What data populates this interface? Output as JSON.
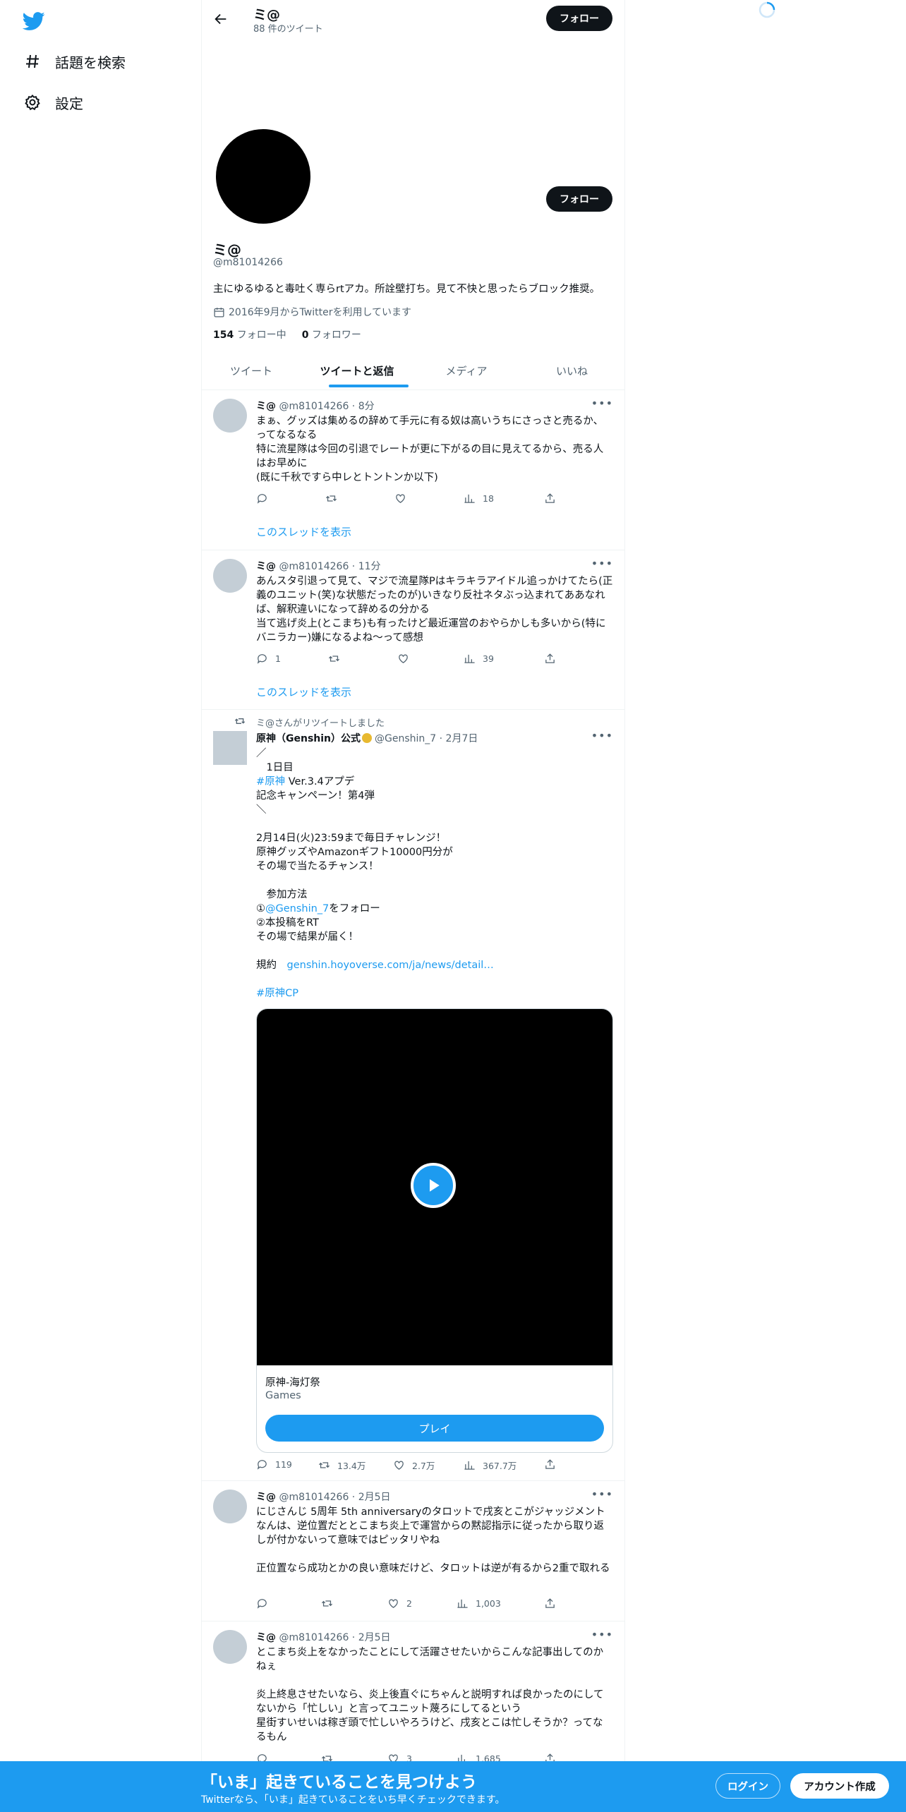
{
  "nav": {
    "items": [
      {
        "label": "話題を検索",
        "icon": "hash-icon"
      },
      {
        "label": "設定",
        "icon": "gear-icon"
      }
    ]
  },
  "header": {
    "name": "ミ@",
    "tweet_count": "88 件のツイート",
    "follow_label": "フォロー"
  },
  "profile": {
    "name": "ミ@",
    "handle": "@m81014266",
    "bio": "主にゆるゆると毒吐く専らrtアカ。所詮壁打ち。見て不快と思ったらブロック推奨。",
    "joined": "2016年9月からTwitterを利用しています",
    "following_count": "154",
    "following_label": "フォロー中",
    "followers_count": "0",
    "followers_label": "フォロワー",
    "follow_label": "フォロー"
  },
  "tabs": [
    "ツイート",
    "ツイートと返信",
    "メディア",
    "いいね"
  ],
  "tweets": [
    {
      "name": "ミ@",
      "meta": "@m81014266 · 8分",
      "body": "まぁ、グッズは集めるの辞めて手元に有る奴は高いうちにさっさと売るか、ってなるなる\n特に流星隊は今回の引退でレートが更に下がるの目に見えてるから、売る人はお早めに\n(既に千秋ですら中レとトントンか以下)",
      "reply": "",
      "retweet": "",
      "like": "",
      "views": "18",
      "thread_link": "このスレッドを表示"
    },
    {
      "name": "ミ@",
      "meta": "@m81014266 · 11分",
      "body": "あんスタ引退って見て、マジで流星隊Pはキラキラアイドル追っかけてたら(正義のユニット(笑)な状態だったのが)いきなり反社ネタぶっ込まれてああなれば、解釈違いになって辞めるの分かる\n当て逃げ炎上(とこまち)も有ったけど最近運営のおやらかしも多いから(特にバニラカー)嫌になるよね〜って感想",
      "reply": "1",
      "retweet": "",
      "like": "",
      "views": "39",
      "thread_link": "このスレッドを表示"
    },
    {
      "retweeted_by": "ミ@さんがリツイートしました",
      "name": "原神（Genshin）公式",
      "meta": "@Genshin_7 · 2月7日",
      "body_part1": "／\n　1日目\n",
      "hashtag1": "#原神",
      "body_part2": " Ver.3.4アプデ\n記念キャンペーン！第4弾\n＼\n\n2月14日(火)23:59まで毎日チャレンジ！\n原神グッズやAmazonギフト10000円分が\nその場で当たるチャンス！\n\n　参加方法\n①",
      "mention": "@Genshin_7",
      "body_part3": "をフォロー\n②本投稿をRT\nその場で結果が届く！\n\n規約　",
      "url": "genshin.hoyoverse.com/ja/news/detail…",
      "hashtag2": "#原神CP",
      "card_title": "原神-海灯祭",
      "card_category": "Games",
      "card_button": "プレイ",
      "reply": "119",
      "retweet": "13.4万",
      "like": "2.7万",
      "views": "367.7万"
    },
    {
      "name": "ミ@",
      "meta": "@m81014266 · 2月5日",
      "body": "にじさんじ 5周年 5th anniversaryのタロットで戌亥とこがジャッジメントなんは、逆位置だととこまち炎上で運営からの黙認指示に従ったから取り返しが付かないって意味ではピッタリやね\n\n正位置なら成功とかの良い意味だけど、タロットは逆が有るから2重で取れる",
      "reply": "",
      "retweet": "",
      "like": "2",
      "views": "1,003"
    },
    {
      "name": "ミ@",
      "meta": "@m81014266 · 2月5日",
      "body": "とこまち炎上をなかったことにして活躍させたいからこんな記事出してのかねぇ\n\n炎上終息させたいなら、炎上後直ぐにちゃんと説明すれば良かったのにしてないから「忙しい」と言ってユニット蔑ろにしてるという\n星街すいせいは稼ぎ頭で忙しいやろうけど、戌亥とこは忙しそうか？ってなるもん",
      "reply": "",
      "retweet": "",
      "like": "3",
      "views": "1,685"
    }
  ],
  "bottom_bar": {
    "headline": "「いま」起きていることを見つけよう",
    "subtext": "Twitterなら、「いま」起きていることをいち早くチェックできます。",
    "login": "ログイン",
    "signup": "アカウント作成"
  },
  "colors": {
    "brand": "#1d9bf0",
    "text": "#0f1419",
    "muted": "#536471"
  }
}
